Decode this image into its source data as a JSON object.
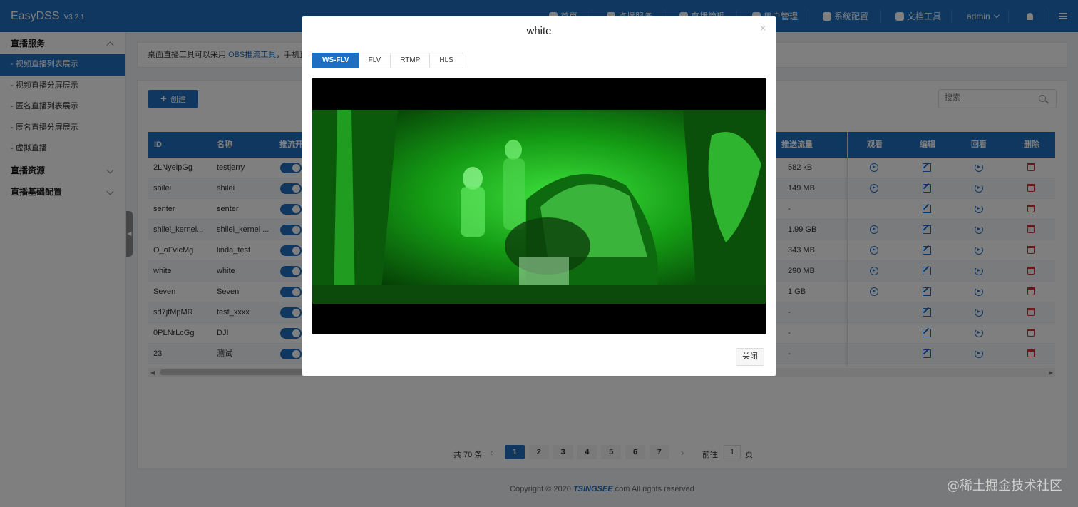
{
  "header": {
    "logo": "EasyDSS",
    "version": "V3.2.1",
    "nav": [
      {
        "label": "首页",
        "icon": "home-icon"
      },
      {
        "label": "点播服务",
        "icon": "vod-icon"
      },
      {
        "label": "直播管理",
        "icon": "live-icon"
      },
      {
        "label": "用户管理",
        "icon": "user-icon"
      },
      {
        "label": "系统配置",
        "icon": "gear-icon"
      },
      {
        "label": "文档工具",
        "icon": "doc-icon"
      }
    ],
    "user": "admin",
    "bell_icon": "bell-icon",
    "menu_icon": "hamburger-icon"
  },
  "sidebar": {
    "groups": [
      {
        "label": "直播服务",
        "expanded": true,
        "items": [
          {
            "label": "- 视频直播列表展示",
            "active": true
          },
          {
            "label": "- 视频直播分屏展示"
          },
          {
            "label": "- 匿名直播列表展示"
          },
          {
            "label": "- 匿名直播分屏展示"
          },
          {
            "label": "- 虚拟直播"
          }
        ]
      },
      {
        "label": "直播资源",
        "expanded": false,
        "items": []
      },
      {
        "label": "直播基础配置",
        "expanded": false,
        "items": []
      }
    ]
  },
  "notice": {
    "prefix": "桌面直播工具可以采用 ",
    "link": "OBS推流工具",
    "suffix": "，手机直播可"
  },
  "toolbar": {
    "create_label": "创建",
    "search_placeholder": "搜索"
  },
  "table": {
    "columns": {
      "id": "ID",
      "name": "名称",
      "push_switch": "推流开关",
      "traffic": "推送流量",
      "watch": "观看",
      "edit": "编辑",
      "playback": "回看",
      "delete": "删除"
    },
    "rows": [
      {
        "id": "2LNyeipGg",
        "name": "testjerry",
        "enabled": true,
        "traffic": "582 kB",
        "watch": true
      },
      {
        "id": "shilei",
        "name": "shilei",
        "enabled": true,
        "traffic": "149 MB",
        "watch": true
      },
      {
        "id": "senter",
        "name": "senter",
        "enabled": true,
        "traffic": "-",
        "watch": false
      },
      {
        "id": "shilei_kernel...",
        "name": "shilei_kernel ...",
        "enabled": true,
        "traffic": "1.99 GB",
        "watch": true
      },
      {
        "id": "O_oFvlcMg",
        "name": "linda_test",
        "enabled": true,
        "traffic": "343 MB",
        "watch": true
      },
      {
        "id": "white",
        "name": "white",
        "enabled": true,
        "traffic": "290 MB",
        "watch": true
      },
      {
        "id": "Seven",
        "name": "Seven",
        "enabled": true,
        "traffic": "1 GB",
        "watch": true
      },
      {
        "id": "sd7jfMpMR",
        "name": "test_xxxx",
        "enabled": true,
        "traffic": "-",
        "watch": false
      },
      {
        "id": "0PLNrLcGg",
        "name": "DJI",
        "enabled": true,
        "traffic": "-",
        "watch": false
      },
      {
        "id": "23",
        "name": "测试",
        "enabled": true,
        "traffic": "-",
        "watch": false
      }
    ]
  },
  "pagination": {
    "total_label": "共 70 条",
    "pages": [
      "1",
      "2",
      "3",
      "4",
      "5",
      "6",
      "7"
    ],
    "current": "1",
    "goto_label": "前往",
    "goto_value": "1",
    "page_suffix": "页"
  },
  "footer": {
    "copyright": "Copyright © 2020 ",
    "brand": "TSINGSEE",
    "suffix": ".com All rights reserved"
  },
  "modal": {
    "title": "white",
    "close_x": "×",
    "tabs": [
      {
        "label": "WS-FLV",
        "active": true
      },
      {
        "label": "FLV"
      },
      {
        "label": "RTMP"
      },
      {
        "label": "HLS"
      }
    ],
    "close_label": "关闭"
  },
  "watermark": "@稀土掘金技术社区",
  "colors": {
    "primary": "#1e6fc1",
    "danger": "#d32f2f",
    "video_green": "#2fd12f"
  }
}
